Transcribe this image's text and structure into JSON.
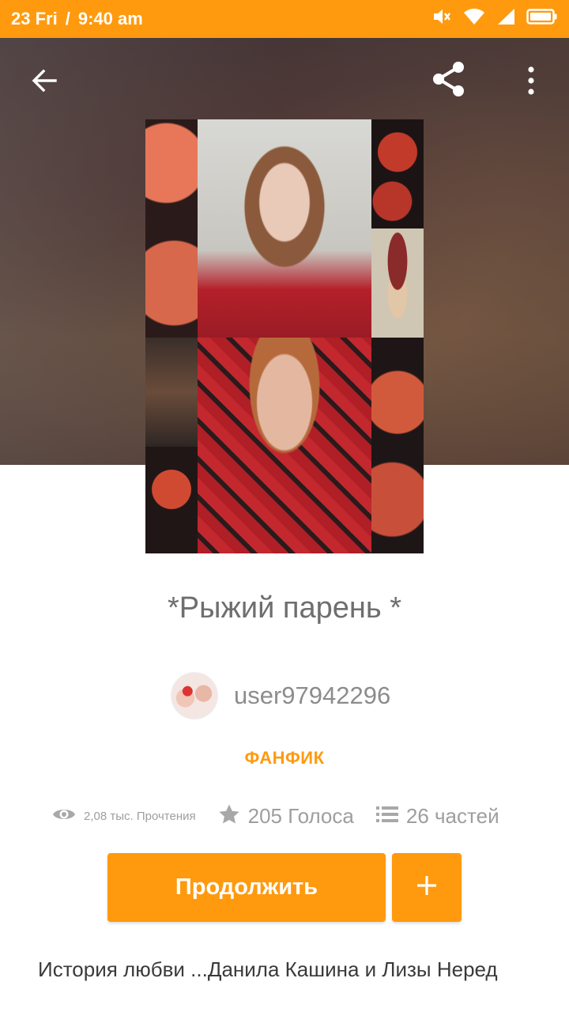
{
  "status_bar": {
    "date": "23 Fri",
    "separator": "/",
    "time": "9:40 am",
    "icons": [
      "mute-icon",
      "wifi-icon",
      "signal-icon",
      "battery-icon"
    ]
  },
  "toolbar": {
    "back_icon": "arrow-left-icon",
    "share_icon": "share-icon",
    "more_icon": "more-vertical-icon"
  },
  "story": {
    "title": "*Рыжий парень *",
    "author": "user97942296",
    "category": "ФАНФИК",
    "reads_label": "2,08 тыс. Прочтения",
    "votes_label": "205 Голоса",
    "parts_label": "26 частей",
    "description": "История любви ...Данила Кашина и Лизы Неред"
  },
  "actions": {
    "continue_label": "Продолжить",
    "add_icon": "plus-icon"
  },
  "colors": {
    "accent": "#ff9a0e",
    "text_muted": "#9e9e9e",
    "title_text": "#6e6e6e"
  }
}
